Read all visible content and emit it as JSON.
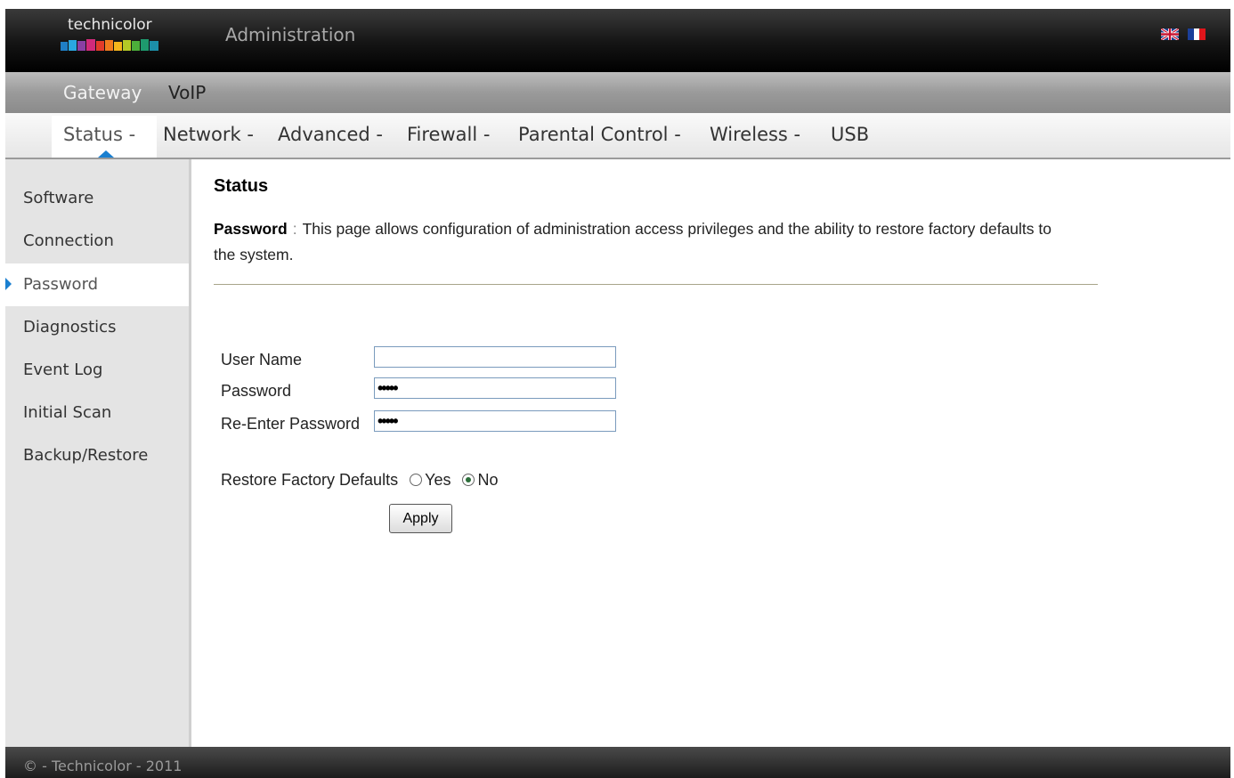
{
  "header": {
    "logo_text": "technicolor",
    "title": "Administration",
    "languages": [
      "english-flag-icon",
      "french-flag-icon"
    ]
  },
  "menu_primary": {
    "items": [
      {
        "label": "Gateway",
        "active": true
      },
      {
        "label": "VoIP",
        "active": false
      }
    ]
  },
  "menu_secondary": {
    "items": [
      {
        "label": "Status -",
        "active": true
      },
      {
        "label": "Network -"
      },
      {
        "label": "Advanced -"
      },
      {
        "label": "Firewall -"
      },
      {
        "label": "Parental Control -"
      },
      {
        "label": "Wireless -"
      },
      {
        "label": "USB"
      }
    ]
  },
  "sidebar": {
    "items": [
      {
        "label": "Software"
      },
      {
        "label": "Connection"
      },
      {
        "label": "Password",
        "active": true
      },
      {
        "label": "Diagnostics"
      },
      {
        "label": "Event Log"
      },
      {
        "label": "Initial Scan"
      },
      {
        "label": "Backup/Restore"
      }
    ]
  },
  "main": {
    "title": "Status",
    "desc_keyword": "Password",
    "desc_separator": ":",
    "desc_text": "This page allows configuration of administration access privileges and the ability to restore factory defaults to the system.",
    "form": {
      "username_label": "User Name",
      "username_value": "",
      "password_label": "Password",
      "password_value": "•••••",
      "reenter_label": "Re-Enter Password",
      "reenter_value": "•••••",
      "restore_label": "Restore Factory Defaults",
      "restore_yes": "Yes",
      "restore_no": "No",
      "restore_selected": "No",
      "apply_label": "Apply"
    }
  },
  "footer": {
    "text": "© - Technicolor - 2011"
  },
  "colors": {
    "accent": "#1a7fd0",
    "header_bg": "#141414",
    "sidebar_bg": "#e4e4e4"
  }
}
